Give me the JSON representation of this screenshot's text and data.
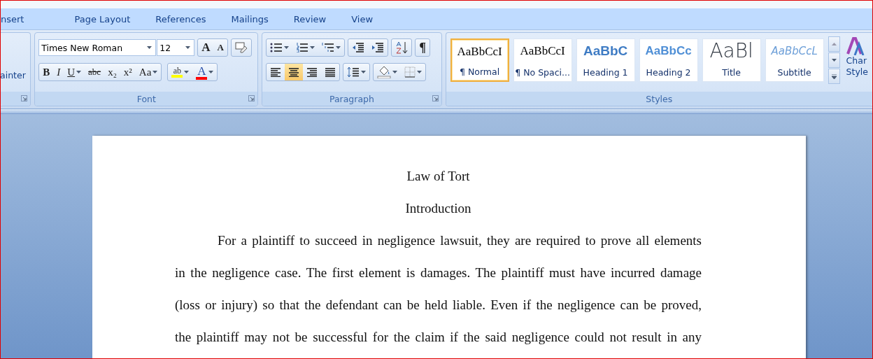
{
  "tabs": [
    {
      "label": "nsert",
      "selected": false
    },
    {
      "label": "Page Layout",
      "selected": false
    },
    {
      "label": "References",
      "selected": false
    },
    {
      "label": "Mailings",
      "selected": false
    },
    {
      "label": "Review",
      "selected": false
    },
    {
      "label": "View",
      "selected": false
    }
  ],
  "clipboard": {
    "label": "ainter"
  },
  "font": {
    "label": "Font",
    "font_name": "Times New Roman",
    "font_size": "12",
    "size_buttons": [
      {
        "label": "A",
        "kind": "grow"
      },
      {
        "label": "A",
        "kind": "shrink"
      }
    ],
    "format_buttons": [
      {
        "label": "B",
        "kind": "bold"
      },
      {
        "label": "I",
        "kind": "italic"
      },
      {
        "label": "U",
        "kind": "underline"
      },
      {
        "label": "abc",
        "kind": "strike"
      },
      {
        "label": "x₂",
        "kind": "sub"
      },
      {
        "label": "x²",
        "kind": "sup"
      },
      {
        "label": "Aa",
        "kind": "case"
      }
    ],
    "color_buttons": [
      {
        "label": "ab",
        "kind": "highlight",
        "color": "#ffff00"
      },
      {
        "label": "A",
        "kind": "fontcolor",
        "color": "#ff0000"
      }
    ]
  },
  "paragraph": {
    "label": "Paragraph",
    "pilcrow": "¶",
    "alignments": [
      {
        "kind": "left",
        "selected": false
      },
      {
        "kind": "center",
        "selected": true
      },
      {
        "kind": "right",
        "selected": false
      },
      {
        "kind": "justify",
        "selected": false
      }
    ]
  },
  "styles": {
    "label": "Styles",
    "items": [
      {
        "preview": "AaBbCcI",
        "label": "¶ Normal",
        "kind": "normal",
        "selected": true
      },
      {
        "preview": "AaBbCcI",
        "label": "¶ No Spaci...",
        "kind": "normal",
        "selected": false
      },
      {
        "preview": "AaBbC",
        "label": "Heading 1",
        "kind": "heading1",
        "selected": false
      },
      {
        "preview": "AaBbCc",
        "label": "Heading 2",
        "kind": "heading2",
        "selected": false
      },
      {
        "preview": "AaBl",
        "label": "Title",
        "kind": "title",
        "selected": false
      },
      {
        "preview": "AaBbCcL",
        "label": "Subtitle",
        "kind": "subtitle",
        "selected": false
      }
    ],
    "change_styles": [
      "Char",
      "Style"
    ]
  },
  "document": {
    "title": "Law of Tort",
    "heading": "Introduction",
    "lines": [
      "For a plaintiff to succeed in negligence lawsuit, they are required to prove all elements",
      "in the negligence case. The first element is damages. The plaintiff must have incurred damage",
      "(loss or injury) so that the defendant can be held liable.  Even if the negligence can be proved,",
      "the plaintiff may not be successful for the claim if the said negligence could not result in any"
    ]
  }
}
